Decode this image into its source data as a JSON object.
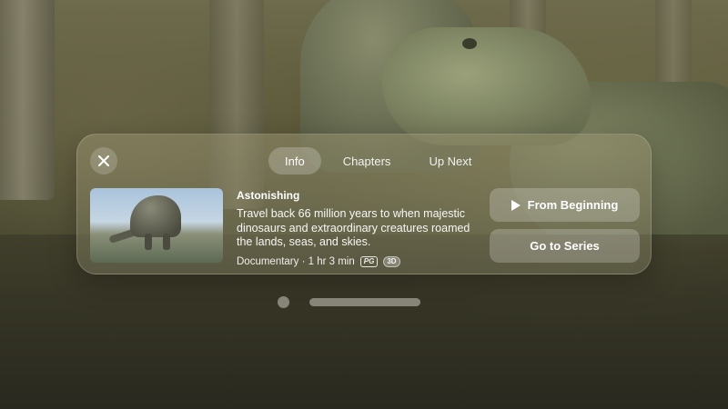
{
  "tabs": [
    {
      "label": "Info",
      "active": true
    },
    {
      "label": "Chapters",
      "active": false
    },
    {
      "label": "Up Next",
      "active": false
    }
  ],
  "item": {
    "title": "Astonishing",
    "description": "Travel back 66 million years to when majestic dinosaurs and extraordinary creatures roamed the lands, seas, and skies.",
    "meta": "Documentary · 1 hr 3 min",
    "rating_badge": "PG",
    "format_badge": "3D"
  },
  "actions": {
    "primary_label": "From Beginning",
    "secondary_label": "Go to Series"
  },
  "icons": {
    "close": "close-icon",
    "play": "play-icon"
  },
  "colors": {
    "panel": "#8f8b6c",
    "text": "#ffffff"
  }
}
